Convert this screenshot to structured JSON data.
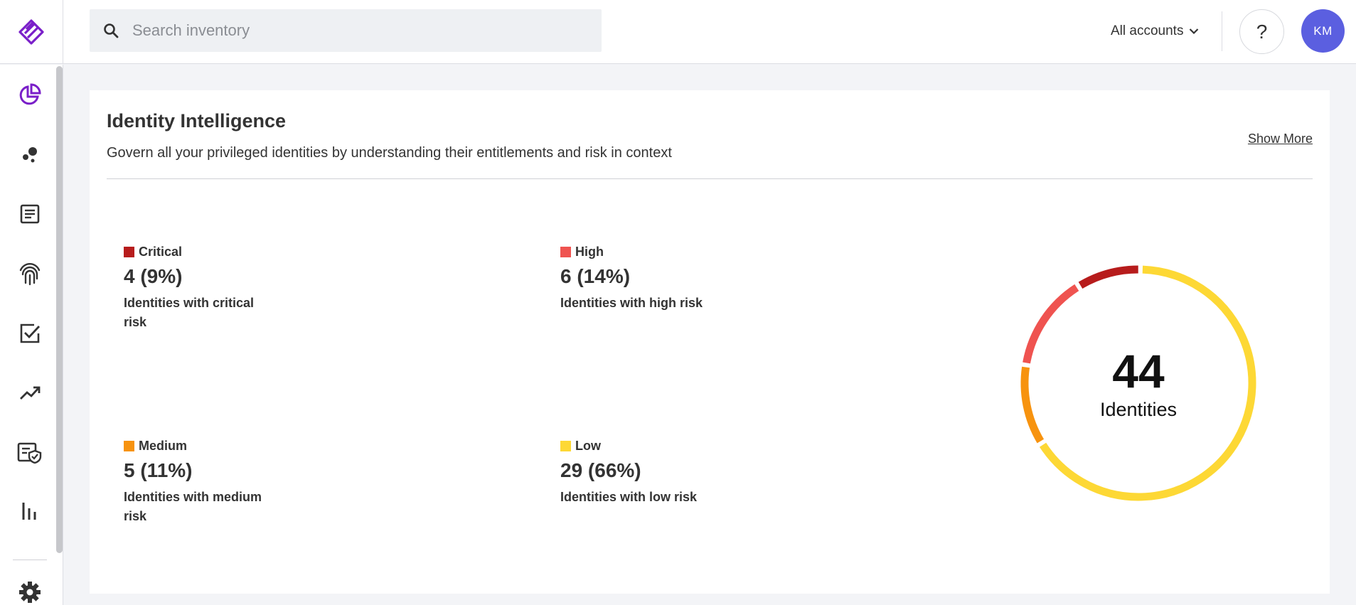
{
  "search": {
    "placeholder": "Search inventory",
    "icon": "search-icon"
  },
  "header": {
    "accounts_label": "All accounts",
    "help_label": "?",
    "avatar_initials": "KM",
    "avatar_color": "#5b5fe0"
  },
  "brand": {
    "accent": "#7a1fc9"
  },
  "sidebar": {
    "items": [
      {
        "icon": "dashboard-pie-icon",
        "active": true
      },
      {
        "icon": "graph-nodes-icon"
      },
      {
        "icon": "document-list-icon"
      },
      {
        "icon": "fingerprint-icon"
      },
      {
        "icon": "task-checkbox-icon"
      },
      {
        "icon": "trend-up-icon"
      },
      {
        "icon": "policy-shield-icon"
      },
      {
        "icon": "bar-chart-icon"
      },
      {
        "icon": "gear-icon"
      }
    ]
  },
  "card": {
    "title": "Identity Intelligence",
    "subtitle": "Govern all your privileged identities by understanding their entitlements and risk in context",
    "show_more": "Show More"
  },
  "risk": {
    "critical": {
      "label": "Critical",
      "value": "4 (9%)",
      "desc": "Identities with critical risk",
      "color": "#b71c1c"
    },
    "high": {
      "label": "High",
      "value": "6 (14%)",
      "desc": "Identities with high risk",
      "color": "#ef5350"
    },
    "medium": {
      "label": "Medium",
      "value": "5 (11%)",
      "desc": "Identities with medium risk",
      "color": "#f7930f"
    },
    "low": {
      "label": "Low",
      "value": "29 (66%)",
      "desc": "Identities with low risk",
      "color": "#fdd835"
    }
  },
  "donut": {
    "total": "44",
    "total_label": "Identities"
  },
  "chart_data": {
    "type": "pie",
    "categories": [
      "Critical",
      "High",
      "Medium",
      "Low"
    ],
    "values": [
      4,
      6,
      5,
      29
    ],
    "colors": [
      "#b71c1c",
      "#ef5350",
      "#f7930f",
      "#fdd835"
    ]
  }
}
